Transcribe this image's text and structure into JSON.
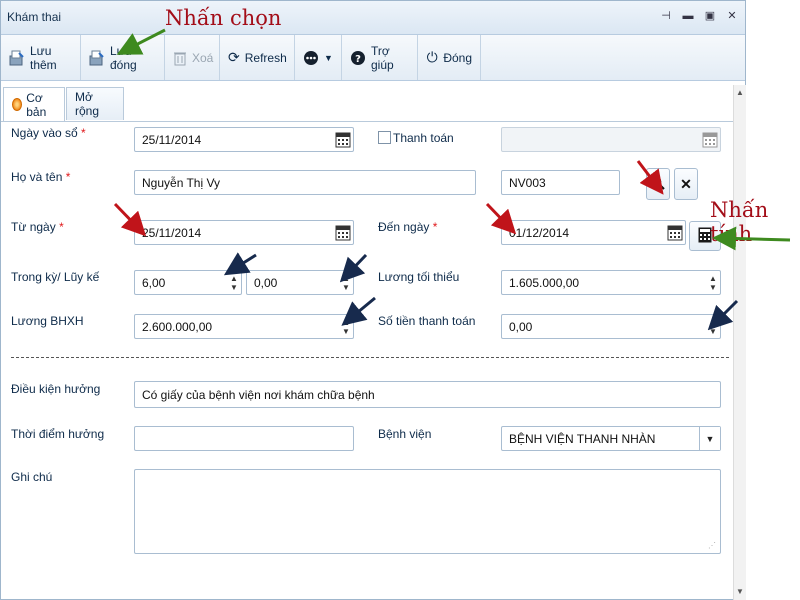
{
  "window": {
    "title": "Khám thai"
  },
  "toolbar": {
    "luu_them": "Lưu thêm",
    "luu_dong": "Lưu đóng",
    "xoa": "Xoá",
    "refresh": "Refresh",
    "tro_giup": "Trợ giúp",
    "dong": "Đóng"
  },
  "tabs": {
    "co_ban": "Cơ bản",
    "mo_rong": "Mở rộng"
  },
  "form": {
    "ngay_vao_so": {
      "label": "Ngày vào sổ",
      "value": "25/11/2014"
    },
    "thanh_toan": {
      "label": "Thanh toán"
    },
    "ho_va_ten": {
      "label": "Họ và tên",
      "value": "Nguyễn Thị Vy",
      "code": "NV003"
    },
    "tu_ngay": {
      "label": "Từ ngày",
      "value": "25/11/2014"
    },
    "den_ngay": {
      "label": "Đến ngày",
      "value": "01/12/2014"
    },
    "trong_ky": {
      "label": "Trong kỳ/ Lũy kế",
      "value1": "6,00",
      "value2": "0,00"
    },
    "luong_toi_thieu": {
      "label": "Lương tối thiểu",
      "value": "1.605.000,00"
    },
    "luong_bhxh": {
      "label": "Lương BHXH",
      "value": "2.600.000,00"
    },
    "so_tien_thanh_toan": {
      "label": "Số tiền thanh toán",
      "value": "0,00"
    },
    "dieu_kien_huong": {
      "label": "Điều kiện hưởng",
      "value": "Có giấy của bệnh viện nơi khám chữa bệnh"
    },
    "thoi_diem_huong": {
      "label": "Thời điểm hưởng",
      "value": ""
    },
    "benh_vien": {
      "label": "Bệnh viện",
      "value": "BỆNH VIỆN THANH NHÀN"
    },
    "ghi_chu": {
      "label": "Ghi chú",
      "value": ""
    }
  },
  "annotations": {
    "nhan_chon": "Nhấn chọn",
    "nhan_tinh": "Nhấn tính"
  },
  "colors": {
    "arrow_green": "#3e8a1f",
    "arrow_red": "#c0141a",
    "arrow_dark": "#172a4d",
    "note_text": "#a30d18"
  }
}
